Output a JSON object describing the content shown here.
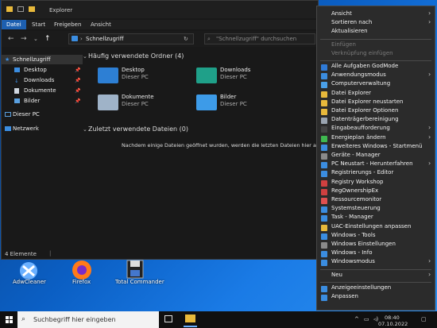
{
  "explorer": {
    "title": "Explorer",
    "ribbon_tabs": [
      "Datei",
      "Start",
      "Freigeben",
      "Ansicht"
    ],
    "address": "Schnellzugriff",
    "search_placeholder": "\"Schnellzugriff\" durchsuchen",
    "nav_items": [
      {
        "label": "Schnellzugriff"
      },
      {
        "label": "Desktop"
      },
      {
        "label": "Downloads"
      },
      {
        "label": "Dokumente"
      },
      {
        "label": "Bilder"
      },
      {
        "label": "Dieser PC"
      },
      {
        "label": "Netzwerk"
      }
    ],
    "section_frequent": "Häufig verwendete Ordner (4)",
    "folders": [
      {
        "name": "Desktop",
        "sub": "Dieser PC"
      },
      {
        "name": "Downloads",
        "sub": "Dieser PC"
      },
      {
        "name": "Dokumente",
        "sub": "Dieser PC"
      },
      {
        "name": "Bilder",
        "sub": "Dieser PC"
      }
    ],
    "section_recent": "Zuletzt verwendete Dateien (0)",
    "recent_empty": "Nachdem einige Dateien geöffnet wurden, werden die letzten Dateien hier angezeigt.",
    "status": "4 Elemente"
  },
  "desktop_icons": [
    {
      "label": "AdwCleaner"
    },
    {
      "label": "Firefox"
    },
    {
      "label": "Total Commander"
    }
  ],
  "menu": {
    "items": [
      {
        "label": "Ansicht",
        "sub": true
      },
      {
        "label": "Sortieren nach",
        "sub": true
      },
      {
        "label": "Aktualisieren"
      },
      {
        "label": "Einfügen",
        "disabled": true
      },
      {
        "label": "Verknüpfung einfügen",
        "disabled": true
      },
      {
        "label": "Alle Aufgaben GodMode",
        "color": "#2f7ad6"
      },
      {
        "label": "Anwendungsmodus",
        "sub": true,
        "color": "#3b8de0"
      },
      {
        "label": "Computerverwaltung",
        "color": "#4aa0e8"
      },
      {
        "label": "Datei Explorer",
        "color": "#e8b93b"
      },
      {
        "label": "Datei Explorer neustarten",
        "color": "#e8b93b"
      },
      {
        "label": "Datei Explorer Optionen",
        "color": "#e8b93b"
      },
      {
        "label": "Datenträgerbereinigung",
        "color": "#9aa4b0"
      },
      {
        "label": "Eingabeaufforderung",
        "sub": true,
        "color": "#444444"
      },
      {
        "label": "Energieplan ändern",
        "sub": true,
        "color": "#3fb950"
      },
      {
        "label": "Erweiteres Windows - Startmenü",
        "color": "#3b8de0"
      },
      {
        "label": "Geräte - Manager",
        "color": "#8a8a8a"
      },
      {
        "label": "PC Neustart - Herunterfahren",
        "sub": true,
        "color": "#3b8de0"
      },
      {
        "label": "Registrierungs - Editor",
        "color": "#3b8de0"
      },
      {
        "label": "Registry Workshop",
        "color": "#d04040"
      },
      {
        "label": "RegOwnershipEx",
        "color": "#d04040"
      },
      {
        "label": "Ressourcemonitor",
        "color": "#e05050"
      },
      {
        "label": "Systemsteuerung",
        "color": "#3b8de0"
      },
      {
        "label": "Task - Manager",
        "color": "#3b8de0"
      },
      {
        "label": "UAC-Einstellungen anpassen",
        "color": "#e8b93b"
      },
      {
        "label": "Windows - Tools",
        "color": "#3b8de0"
      },
      {
        "label": "Windows Einstellungen",
        "color": "#8a8a8a"
      },
      {
        "label": "Windows - Info",
        "color": "#3b8de0"
      },
      {
        "label": "Windowsmodus",
        "sub": true,
        "color": "#3b8de0"
      },
      {
        "label": "Neu",
        "sub": true
      },
      {
        "label": "Anzeigeeinstellungen",
        "color": "#3b8de0"
      },
      {
        "label": "Anpassen",
        "color": "#3b8de0"
      }
    ]
  },
  "taskbar": {
    "search_placeholder": "Suchbegriff hier eingeben",
    "time": "08:40",
    "date": "07.10.2022"
  }
}
